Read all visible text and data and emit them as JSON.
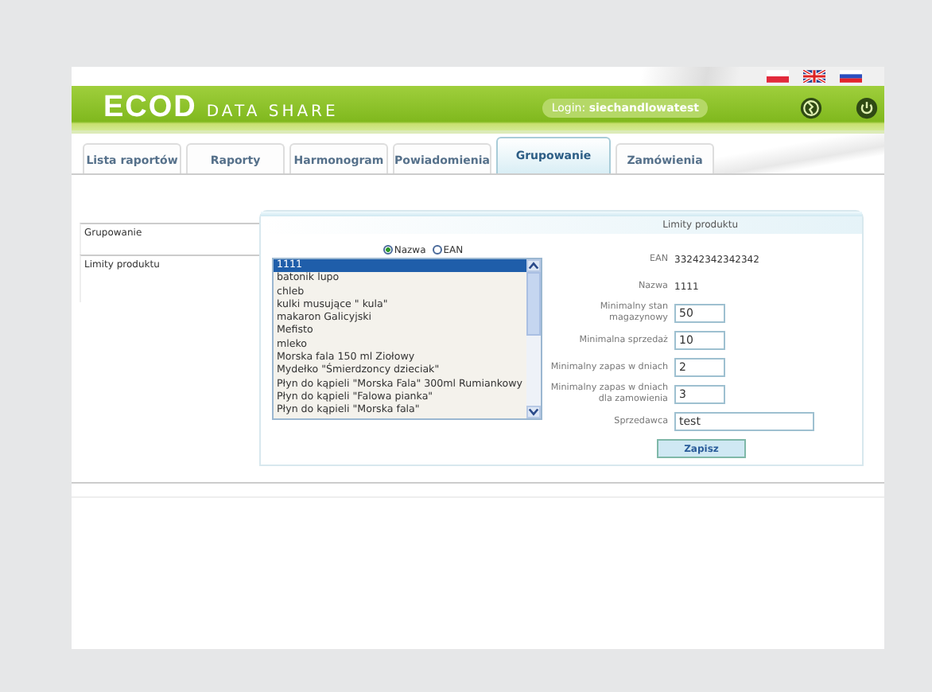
{
  "header": {
    "logo": "ECOD",
    "logo_subtitle": "DATA SHARE",
    "login_label": "Login:",
    "login_user": "siechandlowatest"
  },
  "tabs": [
    {
      "label": "Lista raportów",
      "selected": false
    },
    {
      "label": "Raporty",
      "selected": false
    },
    {
      "label": "Harmonogram",
      "selected": false
    },
    {
      "label": "Powiadomienia",
      "selected": false
    },
    {
      "label": "Grupowanie",
      "selected": true
    },
    {
      "label": "Zamówienia",
      "selected": false
    }
  ],
  "sidebar": {
    "items": [
      {
        "label": "Grupowanie"
      },
      {
        "label": "Limity produktu"
      }
    ]
  },
  "panel": {
    "title": "Limity produktu",
    "search_by": [
      {
        "label": "Nazwa",
        "selected": true
      },
      {
        "label": "EAN",
        "selected": false
      }
    ],
    "products": [
      {
        "label": "1111",
        "selected": true
      },
      {
        "label": "batonik lupo",
        "selected": false
      },
      {
        "label": "chleb",
        "selected": false
      },
      {
        "label": "kulki musujące \" kula\"",
        "selected": false
      },
      {
        "label": "makaron Galicyjski",
        "selected": false
      },
      {
        "label": "Mefisto",
        "selected": false
      },
      {
        "label": "mleko",
        "selected": false
      },
      {
        "label": "Morska fala 150 ml Ziołowy",
        "selected": false
      },
      {
        "label": "Mydełko \"Śmierdzoncy dzieciak\"",
        "selected": false
      },
      {
        "label": "Płyn do kąpieli \"Morska Fala\" 300ml Rumiankowy",
        "selected": false
      },
      {
        "label": "Płyn do kąpieli \"Falowa pianka\"",
        "selected": false
      },
      {
        "label": "Płyn do kąpieli \"Morska fala\"",
        "selected": false
      }
    ],
    "fields": [
      {
        "label": "EAN",
        "kind": "text",
        "value": "33242342342342"
      },
      {
        "label": "Nazwa",
        "kind": "text",
        "value": "1111"
      },
      {
        "label": "Minimalny stan magazynowy",
        "kind": "input",
        "value": "50"
      },
      {
        "label": "Minimalna sprzedaż",
        "kind": "input",
        "value": "10"
      },
      {
        "label": "Minimalny zapas w dniach",
        "kind": "input",
        "value": "2"
      },
      {
        "label": "Minimalny zapas w dniach dla zamowienia",
        "kind": "input",
        "value": "3"
      },
      {
        "label": "Sprzedawca",
        "kind": "wide",
        "value": "test"
      }
    ],
    "save_button": "Zapisz"
  }
}
